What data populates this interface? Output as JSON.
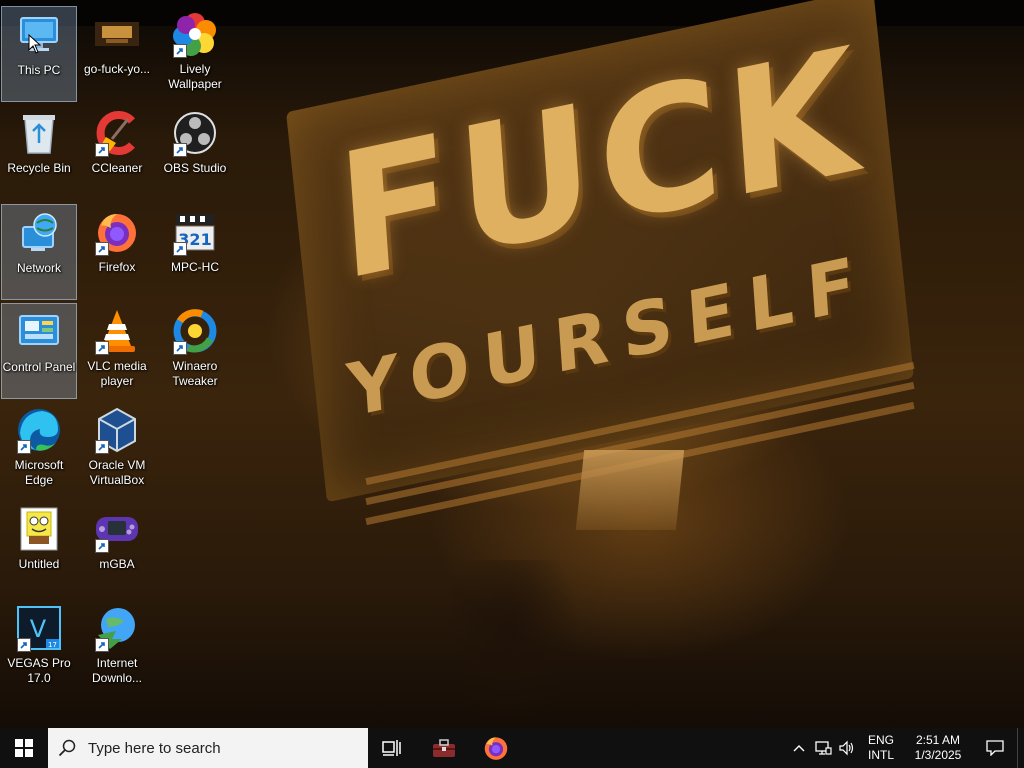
{
  "wallpaper": {
    "title": "FUCK",
    "subtitle": "YOURSELF"
  },
  "desktop_icons": [
    {
      "id": "this-pc",
      "label": "This PC",
      "icon": "computer-icon",
      "shortcut": false,
      "selected": true
    },
    {
      "id": "go-fuck",
      "label": "go-fuck-yo...",
      "icon": "gif-file-icon",
      "shortcut": false,
      "selected": false
    },
    {
      "id": "lively",
      "label": "Lively Wallpaper",
      "icon": "lively-wallpaper-icon",
      "shortcut": true,
      "selected": false
    },
    {
      "id": "recycle-bin",
      "label": "Recycle Bin",
      "icon": "recycle-bin-icon",
      "shortcut": false,
      "selected": false
    },
    {
      "id": "ccleaner",
      "label": "CCleaner",
      "icon": "ccleaner-icon",
      "shortcut": true,
      "selected": false
    },
    {
      "id": "obs",
      "label": "OBS Studio",
      "icon": "obs-icon",
      "shortcut": true,
      "selected": false
    },
    {
      "id": "network",
      "label": "Network",
      "icon": "network-icon",
      "shortcut": false,
      "selected": true
    },
    {
      "id": "firefox",
      "label": "Firefox",
      "icon": "firefox-icon",
      "shortcut": true,
      "selected": false
    },
    {
      "id": "mpc-hc",
      "label": "MPC-HC",
      "icon": "mpc-hc-icon",
      "shortcut": true,
      "selected": false
    },
    {
      "id": "control-panel",
      "label": "Control Panel",
      "icon": "control-panel-icon",
      "shortcut": false,
      "selected": true
    },
    {
      "id": "vlc",
      "label": "VLC media player",
      "icon": "vlc-icon",
      "shortcut": true,
      "selected": false
    },
    {
      "id": "winaero",
      "label": "Winaero Tweaker",
      "icon": "winaero-icon",
      "shortcut": true,
      "selected": false
    },
    {
      "id": "edge",
      "label": "Microsoft Edge",
      "icon": "edge-icon",
      "shortcut": true,
      "selected": false
    },
    {
      "id": "virtualbox",
      "label": "Oracle VM VirtualBox",
      "icon": "virtualbox-icon",
      "shortcut": true,
      "selected": false
    },
    {
      "id": "untitled",
      "label": "Untitled",
      "icon": "spongebob-image-icon",
      "shortcut": false,
      "selected": false
    },
    {
      "id": "mgba",
      "label": "mGBA",
      "icon": "mgba-icon",
      "shortcut": true,
      "selected": false
    },
    {
      "id": "vegas",
      "label": "VEGAS Pro 17.0",
      "icon": "vegas-pro-icon",
      "shortcut": true,
      "selected": false
    },
    {
      "id": "idm",
      "label": "Internet Downlo...",
      "icon": "internet-download-manager-icon",
      "shortcut": true,
      "selected": false
    }
  ],
  "taskbar": {
    "search_placeholder": "Type here to search",
    "pinned": [
      {
        "id": "task-view",
        "icon": "task-view-icon"
      },
      {
        "id": "toolbox",
        "icon": "toolbox-icon"
      },
      {
        "id": "firefox",
        "icon": "firefox-icon"
      }
    ],
    "tray": {
      "lang_line1": "ENG",
      "lang_line2": "INTL",
      "time": "2:51 AM",
      "date": "1/3/2025"
    }
  },
  "colors": {
    "taskbar": "#101010",
    "search_bg": "#f3f3f3",
    "wallpaper_text": "#e0b061"
  }
}
